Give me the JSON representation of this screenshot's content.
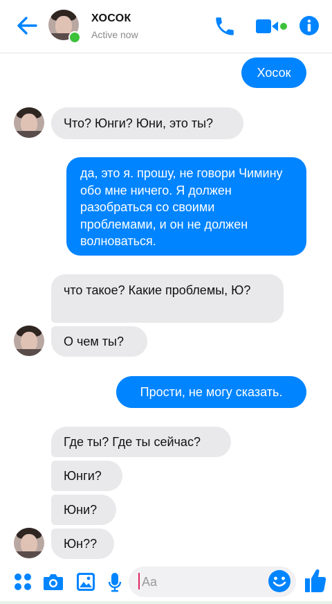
{
  "header": {
    "contact_name": "ХОСОК",
    "status": "Active now",
    "icons": [
      "back-arrow-icon",
      "phone-icon",
      "video-camera-icon",
      "info-icon"
    ],
    "accent_color": "#0084ff",
    "online_color": "#3cc13b"
  },
  "messages": [
    {
      "direction": "outgoing",
      "text": "Хосок"
    },
    {
      "direction": "incoming",
      "text": "Что? Юнги? Юни, это ты?"
    },
    {
      "direction": "outgoing",
      "text": "да, это я. прошу, не говори Чимину обо мне ничего. Я должен разобраться со своими проблемами, и он не должен волноваться."
    },
    {
      "direction": "incoming",
      "text": "что такое? Какие проблемы, Ю?"
    },
    {
      "direction": "incoming",
      "text": "О чем ты?"
    },
    {
      "direction": "outgoing",
      "text": "Прости, не могу сказать."
    },
    {
      "direction": "incoming",
      "text": "Где ты? Где ты сейчас?"
    },
    {
      "direction": "incoming",
      "text": "Юнги?"
    },
    {
      "direction": "incoming",
      "text": "Юни?"
    },
    {
      "direction": "incoming",
      "text": "Юн??"
    }
  ],
  "composer": {
    "placeholder": "Aa",
    "icons": [
      "apps-grid-icon",
      "camera-icon",
      "gallery-icon",
      "microphone-icon",
      "emoji-icon",
      "thumbs-up-icon"
    ]
  }
}
